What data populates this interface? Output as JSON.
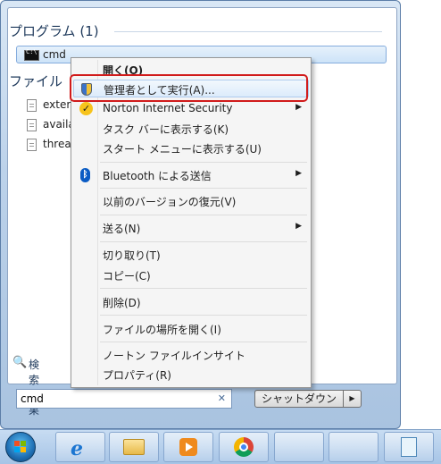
{
  "results": {
    "programs_header": "プログラム (1)",
    "program_item": {
      "label": "cmd",
      "icon": "cmd-icon"
    },
    "files_header": "ファイル",
    "files": [
      {
        "label": "exter",
        "icon": "document-icon"
      },
      {
        "label": "availa",
        "icon": "document-icon"
      },
      {
        "label": "threa",
        "icon": "document-icon"
      }
    ],
    "see_more_label": "検索結果",
    "search_value": "cmd",
    "shutdown_label": "シャットダウン"
  },
  "context_menu": {
    "items": {
      "open": "開く(O)",
      "run_as_admin": "管理者として実行(A)...",
      "norton": "Norton Internet Security",
      "pin_taskbar": "タスク バーに表示する(K)",
      "pin_start": "スタート メニューに表示する(U)",
      "bluetooth": "Bluetooth による送信",
      "restore": "以前のバージョンの復元(V)",
      "send_to": "送る(N)",
      "cut": "切り取り(T)",
      "copy": "コピー(C)",
      "delete": "削除(D)",
      "open_location": "ファイルの場所を開く(I)",
      "norton_insight": "ノートン ファイルインサイト",
      "properties": "プロパティ(R)"
    },
    "highlight_color": "#d11b1b"
  },
  "taskbar": {
    "buttons": [
      "start-orb",
      "internet-explorer",
      "windows-explorer",
      "media-player",
      "chrome",
      "empty",
      "empty",
      "notepad"
    ]
  }
}
